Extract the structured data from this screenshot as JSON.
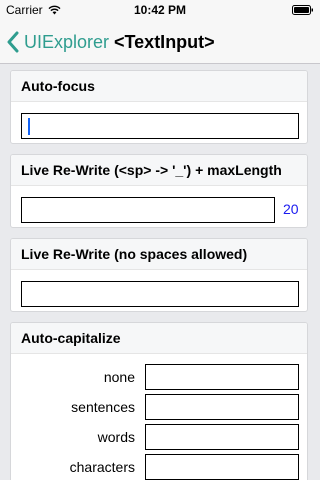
{
  "status_bar": {
    "carrier": "Carrier",
    "time": "10:42 PM"
  },
  "nav": {
    "back_label": "UIExplorer",
    "title": "<TextInput>"
  },
  "sections": {
    "autofocus": {
      "title": "Auto-focus",
      "value": ""
    },
    "live_rewrite": {
      "title": "Live Re-Write (<sp>  ->  '_') + maxLength",
      "value": "",
      "remaining": "20"
    },
    "no_spaces": {
      "title": "Live Re-Write (no spaces allowed)",
      "value": ""
    },
    "autocapitalize": {
      "title": "Auto-capitalize",
      "rows": [
        {
          "label": "none",
          "value": ""
        },
        {
          "label": "sentences",
          "value": ""
        },
        {
          "label": "words",
          "value": ""
        },
        {
          "label": "characters",
          "value": ""
        }
      ]
    }
  },
  "colors": {
    "accent": "#2f9d8f",
    "count": "#1a1af0",
    "caret": "#1464f6",
    "background": "#e9eaed"
  },
  "icons": [
    "wifi-icon",
    "battery-icon",
    "chevron-left-icon"
  ]
}
